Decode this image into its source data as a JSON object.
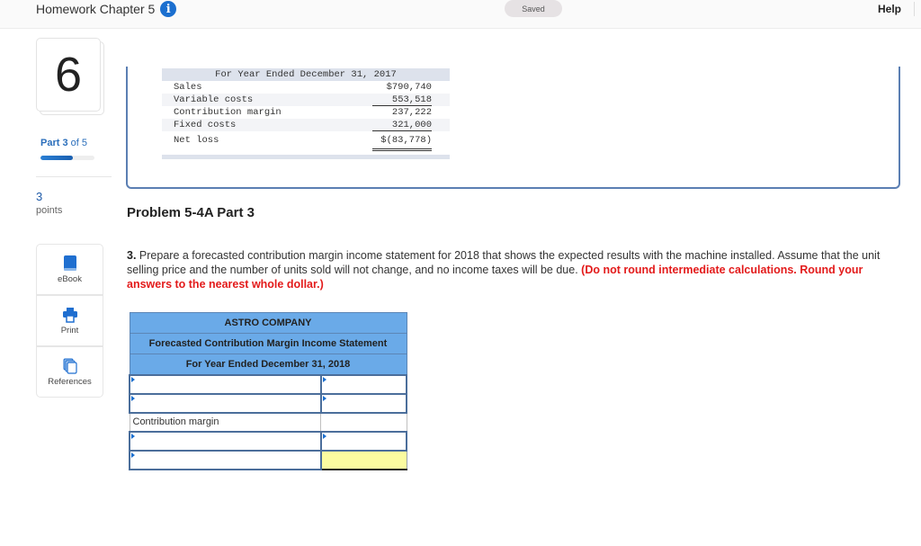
{
  "header": {
    "title": "Homework Chapter 5",
    "info_icon": "info-icon",
    "status": "Saved",
    "help": "Help"
  },
  "sidebar": {
    "question_number": "6",
    "part_word": "Part",
    "part_current": "3",
    "part_of": "of 5",
    "part_progress_fraction": 0.6,
    "points_value": "3",
    "points_label": "points",
    "tools": [
      {
        "label": "eBook",
        "icon": "book-icon"
      },
      {
        "label": "Print",
        "icon": "printer-icon"
      },
      {
        "label": "References",
        "icon": "references-icon"
      }
    ]
  },
  "reference_statement": {
    "period": "For Year Ended December 31, 2017",
    "rows": [
      {
        "label": "Sales",
        "value": "$790,740"
      },
      {
        "label": "Variable costs",
        "value": "553,518"
      },
      {
        "label": "Contribution margin",
        "value": "237,222"
      },
      {
        "label": "Fixed costs",
        "value": "321,000"
      },
      {
        "label": "Net loss",
        "value": "$(83,778)"
      }
    ]
  },
  "problem": {
    "title": "Problem 5-4A Part 3",
    "number": "3.",
    "text": "Prepare a forecasted contribution margin income statement for 2018 that shows the expected results with the machine installed. Assume that the unit selling price and the number of units sold will not change, and no income taxes will be due.",
    "instruction": "(Do not round intermediate calculations. Round your answers to the nearest whole dollar.)"
  },
  "answer_table": {
    "company": "ASTRO COMPANY",
    "statement": "Forecasted Contribution Margin Income Statement",
    "period": "For Year Ended December 31, 2018",
    "rows": [
      {
        "label": "",
        "value": "",
        "label_input": true,
        "value_input": true
      },
      {
        "label": "",
        "value": "",
        "label_input": true,
        "value_input": true
      },
      {
        "label": "Contribution margin",
        "value": "",
        "label_input": false,
        "value_input": false
      },
      {
        "label": "",
        "value": "",
        "label_input": true,
        "value_input": true
      },
      {
        "label": "",
        "value": "",
        "label_input": true,
        "value_input": true,
        "highlight_color": "#fcfca0"
      }
    ]
  },
  "colors": {
    "accent_blue": "#1b6fcf",
    "header_blue": "#6aaae8",
    "instruction_red": "#e31b1b",
    "highlight_yellow": "#fcfca0"
  }
}
